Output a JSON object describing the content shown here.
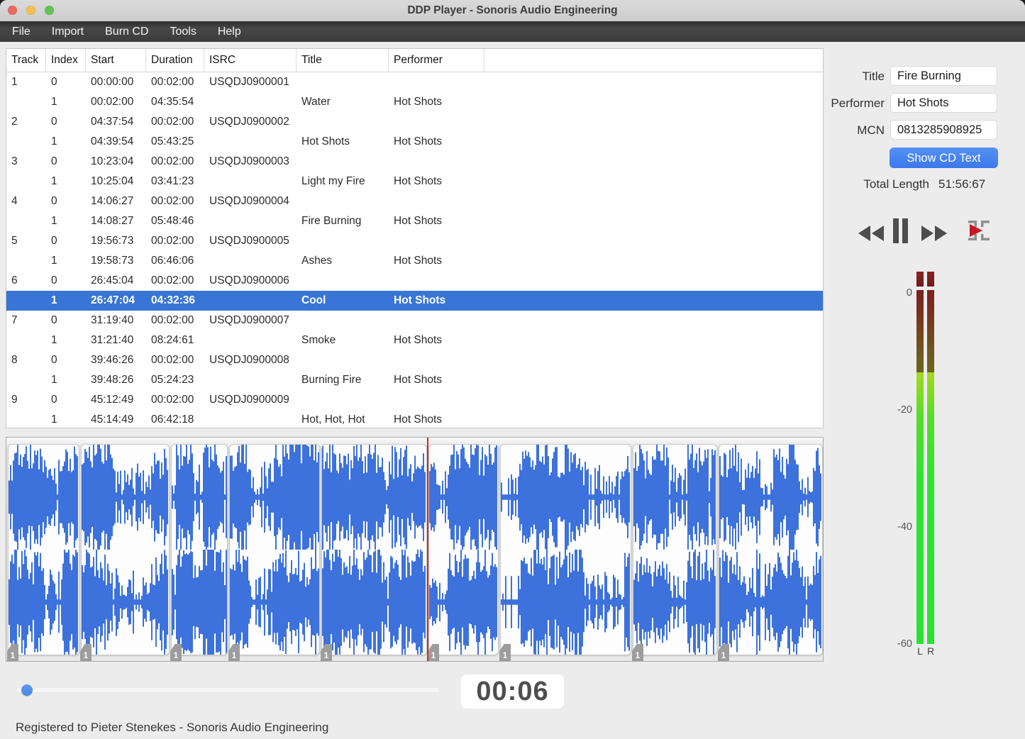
{
  "window": {
    "title": "DDP Player - Sonoris Audio Engineering"
  },
  "menu": {
    "items": [
      "File",
      "Import",
      "Burn CD",
      "Tools",
      "Help"
    ]
  },
  "table": {
    "columns": [
      "Track",
      "Index",
      "Start",
      "Duration",
      "ISRC",
      "Title",
      "Performer"
    ],
    "rows": [
      {
        "track": "1",
        "index": "0",
        "start": "00:00:00",
        "duration": "00:02:00",
        "isrc": "USQDJ0900001",
        "title": "",
        "performer": "",
        "selected": false
      },
      {
        "track": "",
        "index": "1",
        "start": "00:02:00",
        "duration": "04:35:54",
        "isrc": "",
        "title": "Water",
        "performer": "Hot Shots",
        "selected": false
      },
      {
        "track": "2",
        "index": "0",
        "start": "04:37:54",
        "duration": "00:02:00",
        "isrc": "USQDJ0900002",
        "title": "",
        "performer": "",
        "selected": false
      },
      {
        "track": "",
        "index": "1",
        "start": "04:39:54",
        "duration": "05:43:25",
        "isrc": "",
        "title": "Hot Shots",
        "performer": "Hot Shots",
        "selected": false
      },
      {
        "track": "3",
        "index": "0",
        "start": "10:23:04",
        "duration": "00:02:00",
        "isrc": "USQDJ0900003",
        "title": "",
        "performer": "",
        "selected": false
      },
      {
        "track": "",
        "index": "1",
        "start": "10:25:04",
        "duration": "03:41:23",
        "isrc": "",
        "title": "Light my Fire",
        "performer": "Hot Shots",
        "selected": false
      },
      {
        "track": "4",
        "index": "0",
        "start": "14:06:27",
        "duration": "00:02:00",
        "isrc": "USQDJ0900004",
        "title": "",
        "performer": "",
        "selected": false
      },
      {
        "track": "",
        "index": "1",
        "start": "14:08:27",
        "duration": "05:48:46",
        "isrc": "",
        "title": "Fire Burning",
        "performer": "Hot Shots",
        "selected": false
      },
      {
        "track": "5",
        "index": "0",
        "start": "19:56:73",
        "duration": "00:02:00",
        "isrc": "USQDJ0900005",
        "title": "",
        "performer": "",
        "selected": false
      },
      {
        "track": "",
        "index": "1",
        "start": "19:58:73",
        "duration": "06:46:06",
        "isrc": "",
        "title": "Ashes",
        "performer": "Hot Shots",
        "selected": false
      },
      {
        "track": "6",
        "index": "0",
        "start": "26:45:04",
        "duration": "00:02:00",
        "isrc": "USQDJ0900006",
        "title": "",
        "performer": "",
        "selected": false
      },
      {
        "track": "",
        "index": "1",
        "start": "26:47:04",
        "duration": "04:32:36",
        "isrc": "",
        "title": "Cool",
        "performer": "Hot Shots",
        "selected": true
      },
      {
        "track": "7",
        "index": "0",
        "start": "31:19:40",
        "duration": "00:02:00",
        "isrc": "USQDJ0900007",
        "title": "",
        "performer": "",
        "selected": false
      },
      {
        "track": "",
        "index": "1",
        "start": "31:21:40",
        "duration": "08:24:61",
        "isrc": "",
        "title": "Smoke",
        "performer": "Hot Shots",
        "selected": false
      },
      {
        "track": "8",
        "index": "0",
        "start": "39:46:26",
        "duration": "00:02:00",
        "isrc": "USQDJ0900008",
        "title": "",
        "performer": "",
        "selected": false
      },
      {
        "track": "",
        "index": "1",
        "start": "39:48:26",
        "duration": "05:24:23",
        "isrc": "",
        "title": "Burning Fire",
        "performer": "Hot Shots",
        "selected": false
      },
      {
        "track": "9",
        "index": "0",
        "start": "45:12:49",
        "duration": "00:02:00",
        "isrc": "USQDJ0900009",
        "title": "",
        "performer": "",
        "selected": false
      },
      {
        "track": "",
        "index": "1",
        "start": "45:14:49",
        "duration": "06:42:18",
        "isrc": "",
        "title": "Hot, Hot, Hot",
        "performer": "Hot Shots",
        "selected": false
      }
    ]
  },
  "details": {
    "title_label": "Title",
    "title_value": "Fire Burning",
    "performer_label": "Performer",
    "performer_value": "Hot Shots",
    "mcn_label": "MCN",
    "mcn_value": "0813285908925",
    "show_cd_text_button": "Show CD Text",
    "total_length_label": "Total Length",
    "total_length_value": "51:56:67"
  },
  "transport": {
    "icons": [
      "rewind-icon",
      "pause-icon",
      "fast-forward-icon",
      "play-track-range-icon"
    ]
  },
  "meter": {
    "ticks": [
      "0",
      "-20",
      "-40",
      "-60"
    ],
    "channel_labels": [
      "L",
      "R"
    ],
    "level_db": -14,
    "clip_indicator": true
  },
  "waveform": {
    "marker_label": "1",
    "track_fractions": [
      0,
      0.0891,
      0.1999,
      0.2715,
      0.384,
      0.5149,
      0.6029,
      0.7656,
      0.8702,
      1.0
    ],
    "playhead_fraction": 0.5156
  },
  "player": {
    "time_display": "00:06",
    "slider_fraction": 0.027
  },
  "status": {
    "text": "Registered to Pieter Stenekes - Sonoris Audio Engineering"
  },
  "colors": {
    "selection": "#3875d6",
    "waveform": "#3d72dc",
    "playhead": "#d22a2a",
    "button-top": "#5590f4",
    "button-bottom": "#3c79ea",
    "slider-handle": "#4a86e8",
    "meter-green": "#2ee431",
    "clip-red": "#6f1a1a"
  }
}
